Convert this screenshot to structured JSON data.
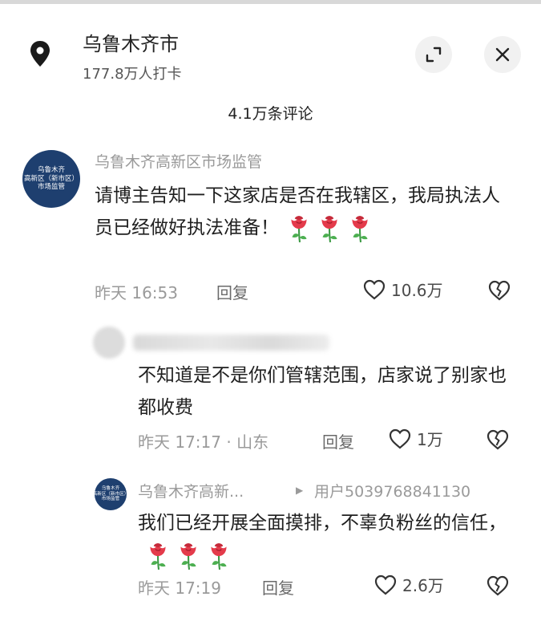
{
  "header": {
    "location_name": "乌鲁木齐市",
    "checkins": "177.8万人打卡",
    "pin_icon": "location-pin-icon",
    "expand_icon": "expand-icon",
    "close_icon": "close-icon"
  },
  "comment_count": "4.1万条评论",
  "comments": [
    {
      "author": "乌鲁木齐高新区市场监管",
      "avatar_lines": [
        "乌鲁木齐",
        "高新区（新市区）",
        "市场监管"
      ],
      "text": "请博主告知一下这家店是否在我辖区，我局执法人员已经做好执法准备！",
      "time": "昨天 16:53",
      "reply_label": "回复",
      "likes": "10.6万"
    },
    {
      "author": "",
      "text": "不知道是不是你们管辖范围，店家说了别家也都收费",
      "time": "昨天 17:17 · 山东",
      "reply_label": "回复",
      "likes": "1万"
    },
    {
      "author": "乌鲁木齐高新...",
      "reply_to": "用户5039768841130",
      "avatar_lines": [
        "乌鲁木齐",
        "高新区（新市区）",
        "市场监管"
      ],
      "text": "我们已经开展全面摸排，不辜负粉丝的信任，",
      "time": "昨天 17:19",
      "reply_label": "回复",
      "likes": "2.6万"
    }
  ],
  "colors": {
    "avatar_bg": "#1e3f6f",
    "meta_gray": "#9a9a9a",
    "rose_red": "#e43b4b"
  }
}
